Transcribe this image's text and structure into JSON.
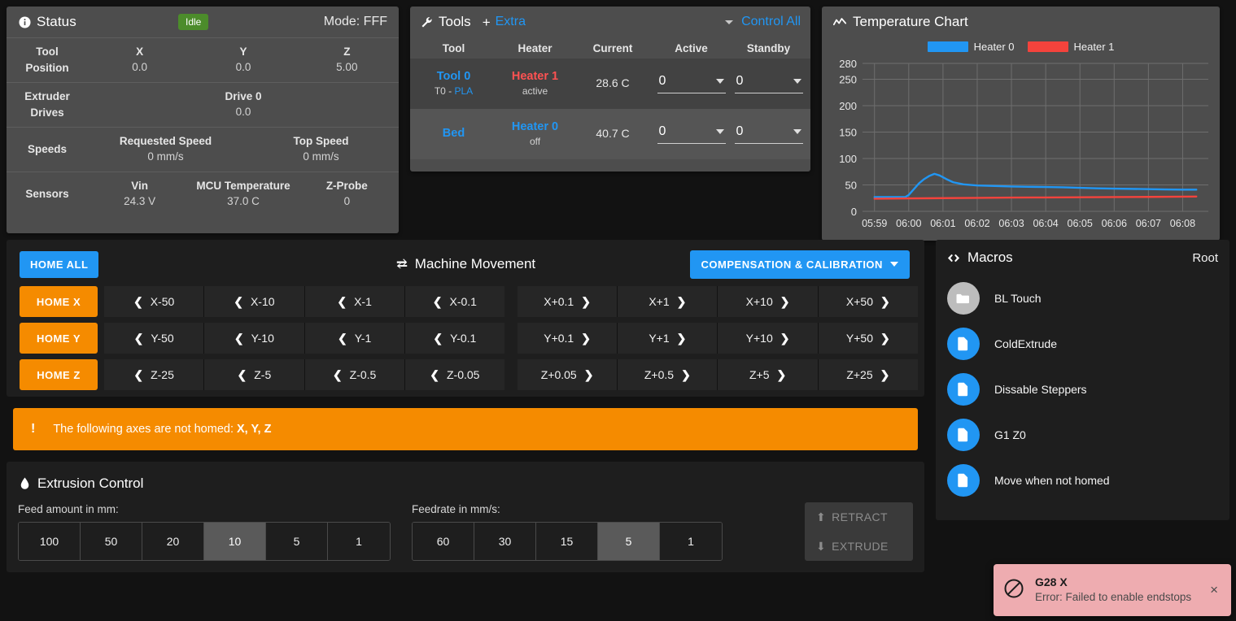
{
  "status": {
    "title": "Status",
    "icon": "info-circle-icon",
    "badge": "Idle",
    "badge_color": "#4c8c2b",
    "mode": "Mode: FFF",
    "rows": [
      {
        "label": "Tool\nPosition",
        "label_line1": "Tool",
        "label_line2": "Position",
        "cells": [
          {
            "key": "X",
            "value": "0.0"
          },
          {
            "key": "Y",
            "value": "0.0"
          },
          {
            "key": "Z",
            "value": "5.00"
          }
        ]
      },
      {
        "label_line1": "Extruder",
        "label_line2": "Drives",
        "cells": [
          {
            "key": "Drive 0",
            "value": "0.0"
          }
        ]
      },
      {
        "label_line1": "Speeds",
        "label_line2": "",
        "cells": [
          {
            "key": "Requested Speed",
            "value": "0 mm/s"
          },
          {
            "key": "Top Speed",
            "value": "0 mm/s"
          }
        ]
      },
      {
        "label_line1": "Sensors",
        "label_line2": "",
        "cells": [
          {
            "key": "Vin",
            "value": "24.3 V"
          },
          {
            "key": "MCU Temperature",
            "value": "37.0 C"
          },
          {
            "key": "Z-Probe",
            "value": "0"
          }
        ]
      }
    ]
  },
  "tools": {
    "title": "Tools",
    "icon": "wrench-icon",
    "plus": "+",
    "extra_label": "Extra",
    "control_all_label": "Control All",
    "headers": [
      "Tool",
      "Heater",
      "Current",
      "Active",
      "Standby"
    ],
    "rows": [
      {
        "tool_name": "Tool 0",
        "tool_sub_prefix": "T0 - ",
        "tool_sub_filament": "PLA",
        "heater_name": "Heater 1",
        "heater_state": "active",
        "heater_color": "#ff5252",
        "current": "28.6 C",
        "active": "0",
        "standby": "0"
      },
      {
        "tool_name": "Bed",
        "tool_sub_prefix": "",
        "tool_sub_filament": "",
        "heater_name": "Heater 0",
        "heater_state": "off",
        "heater_color": "#2196f3",
        "current": "40.7 C",
        "active": "0",
        "standby": "0"
      }
    ]
  },
  "chart": {
    "title": "Temperature Chart",
    "icon": "line-chart-icon"
  },
  "chart_data": {
    "type": "line",
    "title": "Temperature Chart",
    "xlabel": "",
    "ylabel": "",
    "grid": true,
    "legend_position": "top-center",
    "ylim": [
      0,
      280
    ],
    "yticks": [
      0,
      50,
      100,
      150,
      200,
      250,
      280
    ],
    "xticks": [
      "05:59",
      "06:00",
      "06:01",
      "06:02",
      "06:03",
      "06:04",
      "06:05",
      "06:06",
      "06:07",
      "06:08"
    ],
    "series": [
      {
        "name": "Heater 0",
        "color": "#2196f3",
        "x": [
          0,
          0.3,
          0.6,
          0.9,
          1.0,
          1.15,
          1.3,
          1.45,
          1.6,
          1.75,
          1.9,
          2.1,
          2.3,
          2.6,
          3.0,
          3.5,
          4.0,
          4.5,
          5.0,
          5.5,
          6.0,
          6.5,
          7.0,
          7.5,
          8.0,
          8.5,
          9.0,
          9.4
        ],
        "values": [
          27,
          27,
          27,
          27,
          31,
          42,
          53,
          61,
          67,
          71,
          68,
          61,
          55,
          51,
          49,
          48,
          47,
          46.5,
          46,
          45.5,
          44.5,
          43.5,
          43,
          42.5,
          42,
          41.5,
          41,
          41
        ]
      },
      {
        "name": "Heater 1",
        "color": "#f4433c",
        "x": [
          0,
          1,
          2,
          3,
          4,
          5,
          6,
          7,
          8,
          9,
          9.4
        ],
        "values": [
          24,
          24.5,
          25,
          25.5,
          26,
          26.3,
          26.6,
          27,
          27.3,
          27.8,
          28
        ]
      }
    ]
  },
  "movement": {
    "title": "Machine Movement",
    "icon": "arrows-swap-icon",
    "home_all_label": "HOME ALL",
    "compensation_label": "COMPENSATION & CALIBRATION",
    "axes": [
      {
        "home_label": "HOME X",
        "negative": [
          "X-50",
          "X-10",
          "X-1",
          "X-0.1"
        ],
        "positive": [
          "X+0.1",
          "X+1",
          "X+10",
          "X+50"
        ]
      },
      {
        "home_label": "HOME Y",
        "negative": [
          "Y-50",
          "Y-10",
          "Y-1",
          "Y-0.1"
        ],
        "positive": [
          "Y+0.1",
          "Y+1",
          "Y+10",
          "Y+50"
        ]
      },
      {
        "home_label": "HOME Z",
        "negative": [
          "Z-25",
          "Z-5",
          "Z-0.5",
          "Z-0.05"
        ],
        "positive": [
          "Z+0.05",
          "Z+0.5",
          "Z+5",
          "Z+25"
        ]
      }
    ]
  },
  "warning": {
    "icon": "exclamation-icon",
    "exclamation": "!",
    "text": "The following axes are not homed: ",
    "axes": "X, Y, Z",
    "color": "#f58b00"
  },
  "extrusion": {
    "title": "Extrusion Control",
    "icon": "droplet-icon",
    "feed_label": "Feed amount in mm:",
    "feed_options": [
      "100",
      "50",
      "20",
      "10",
      "5",
      "1"
    ],
    "feed_selected": "10",
    "feedrate_label": "Feedrate in mm/s:",
    "feedrate_options": [
      "60",
      "30",
      "15",
      "5",
      "1"
    ],
    "feedrate_selected": "5",
    "retract_label": "RETRACT",
    "extrude_label": "EXTRUDE"
  },
  "macros": {
    "title": "Macros",
    "icon": "code-icon",
    "root_label": "Root",
    "items": [
      {
        "name": "BL Touch",
        "type": "folder"
      },
      {
        "name": "ColdExtrude",
        "type": "file"
      },
      {
        "name": "Dissable Steppers",
        "type": "file"
      },
      {
        "name": "G1 Z0",
        "type": "file"
      },
      {
        "name": "Move when not homed",
        "type": "file"
      }
    ]
  },
  "toast": {
    "icon": "ban-icon",
    "title": "G28 X",
    "message": "Error: Failed to enable endstops",
    "close": "×",
    "background": "#eeacb0"
  }
}
